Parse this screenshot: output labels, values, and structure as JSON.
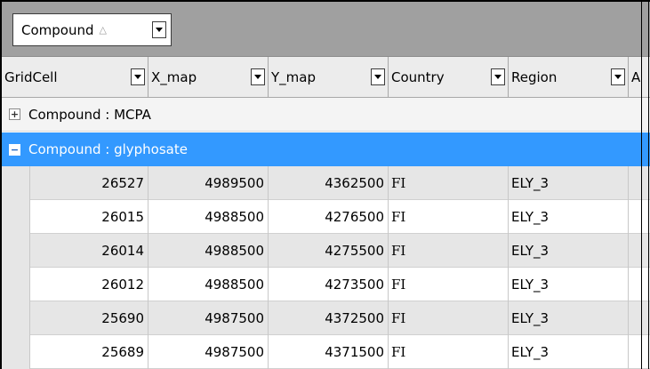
{
  "group_by": {
    "label": "Compound",
    "sort_icon": "sort-ascending-icon"
  },
  "columns": [
    "GridCell",
    "X_map",
    "Y_map",
    "Country",
    "Region",
    "A"
  ],
  "groups": [
    {
      "label": "Compound : MCPA",
      "expanded": false
    },
    {
      "label": "Compound : glyphosate",
      "expanded": true
    }
  ],
  "rows": [
    {
      "GridCell": "26527",
      "X_map": "4989500",
      "Y_map": "4362500",
      "Country": "FI",
      "Region": "ELY_3"
    },
    {
      "GridCell": "26015",
      "X_map": "4988500",
      "Y_map": "4276500",
      "Country": "FI",
      "Region": "ELY_3"
    },
    {
      "GridCell": "26014",
      "X_map": "4988500",
      "Y_map": "4275500",
      "Country": "FI",
      "Region": "ELY_3"
    },
    {
      "GridCell": "26012",
      "X_map": "4988500",
      "Y_map": "4273500",
      "Country": "FI",
      "Region": "ELY_3"
    },
    {
      "GridCell": "25690",
      "X_map": "4987500",
      "Y_map": "4372500",
      "Country": "FI",
      "Region": "ELY_3"
    },
    {
      "GridCell": "25689",
      "X_map": "4987500",
      "Y_map": "4371500",
      "Country": "FI",
      "Region": "ELY_3"
    }
  ],
  "colors": {
    "selection": "#3399ff",
    "group_panel": "#a0a0a0",
    "row_alt": "#e6e6e6"
  }
}
